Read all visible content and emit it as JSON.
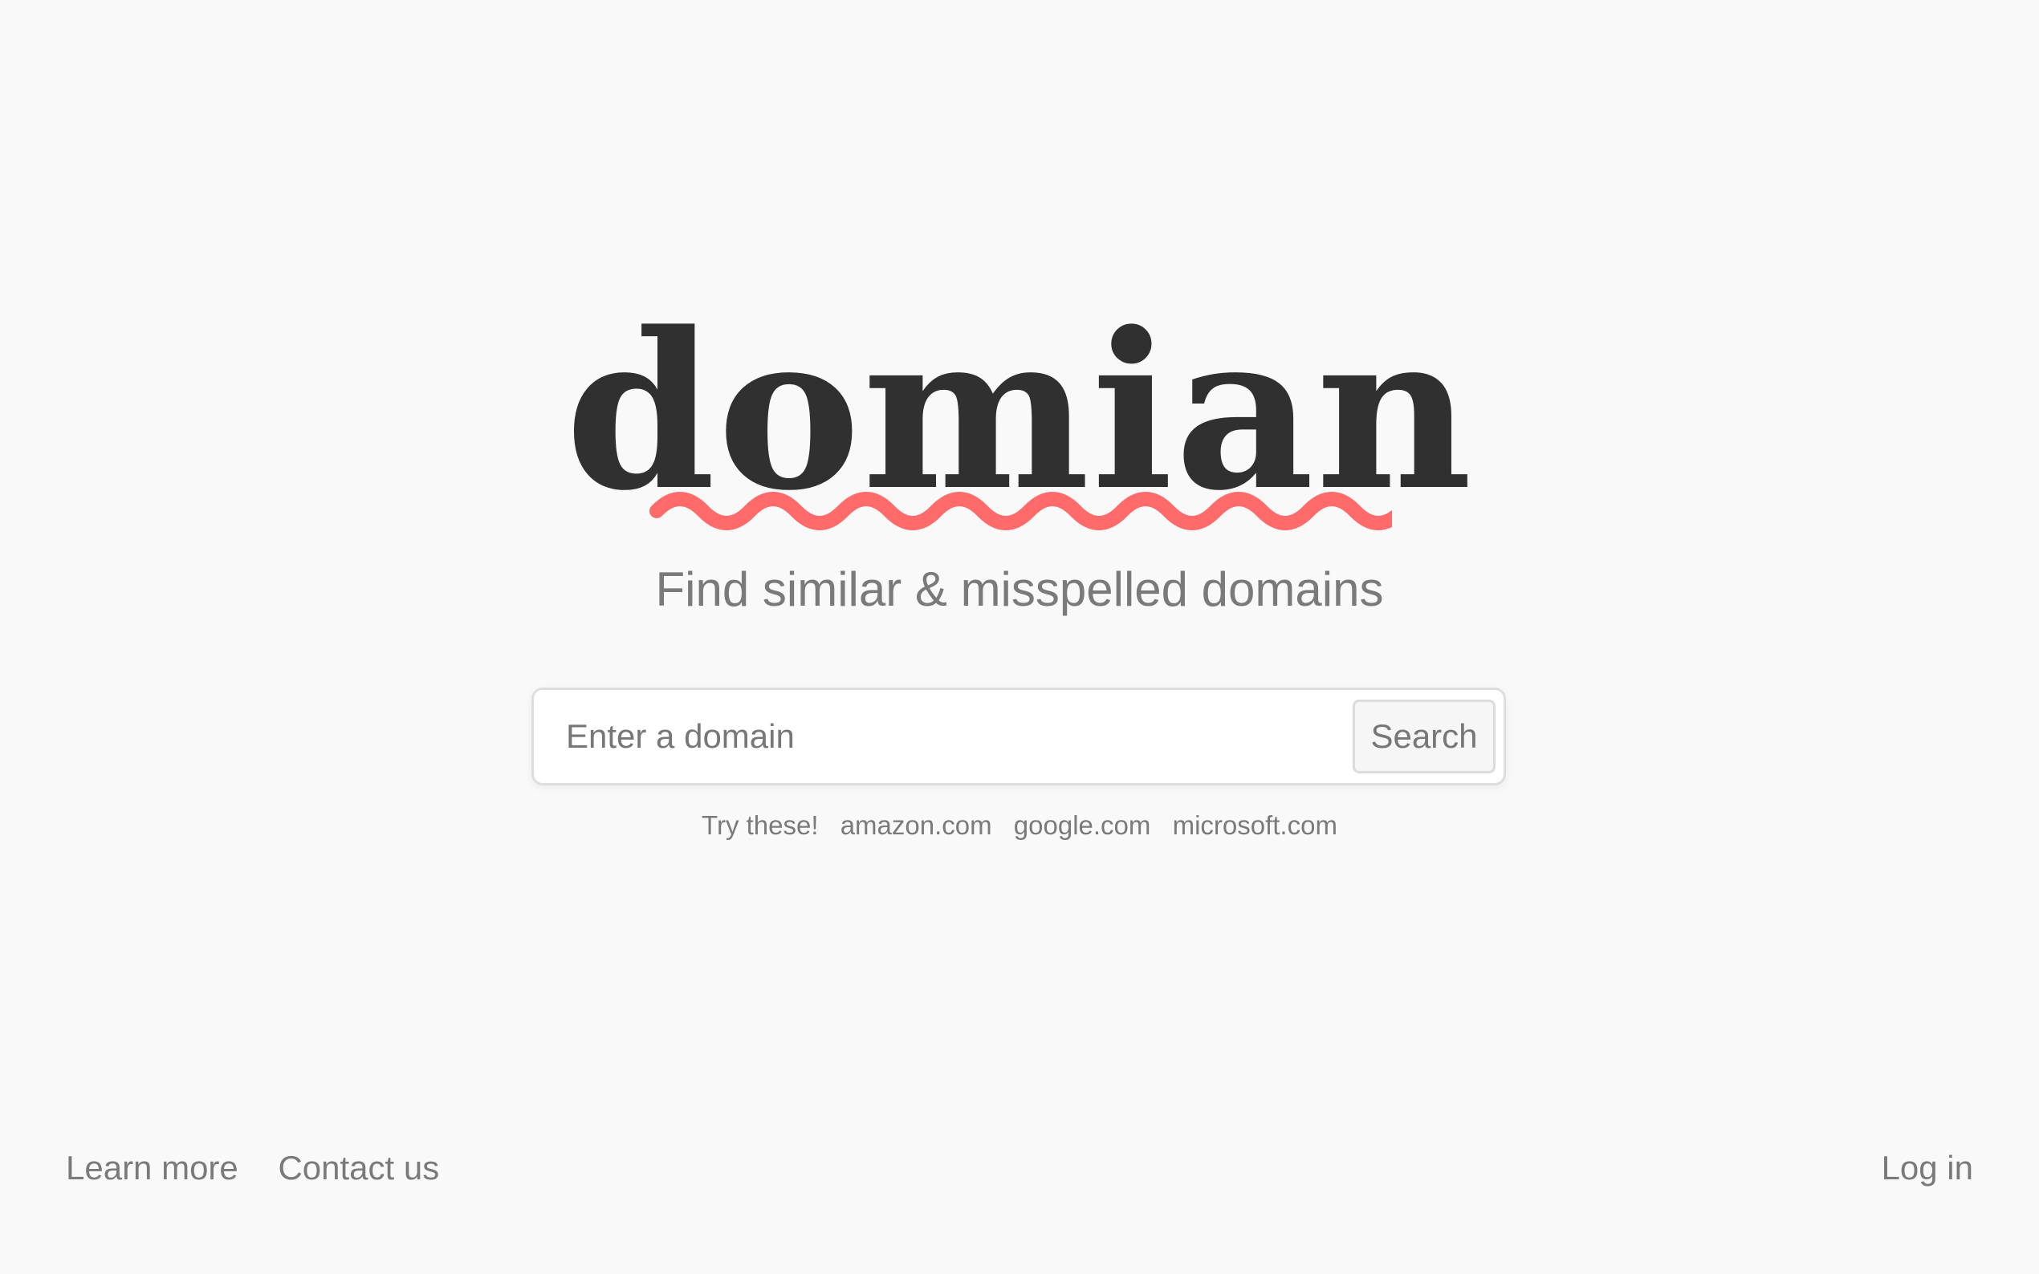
{
  "logo": {
    "text": "domian",
    "squiggle_color": "#ff6b6b",
    "text_color": "#303030"
  },
  "tagline": "Find similar & misspelled domains",
  "search": {
    "placeholder": "Enter a domain",
    "value": "",
    "button_label": "Search"
  },
  "suggestions": {
    "label": "Try these!",
    "items": [
      "amazon.com",
      "google.com",
      "microsoft.com"
    ]
  },
  "footer": {
    "learn_more": "Learn more",
    "contact_us": "Contact us",
    "log_in": "Log in"
  },
  "colors": {
    "background": "#f9f9f9",
    "muted_text": "#7a7a7a",
    "accent": "#ff6b6b"
  }
}
